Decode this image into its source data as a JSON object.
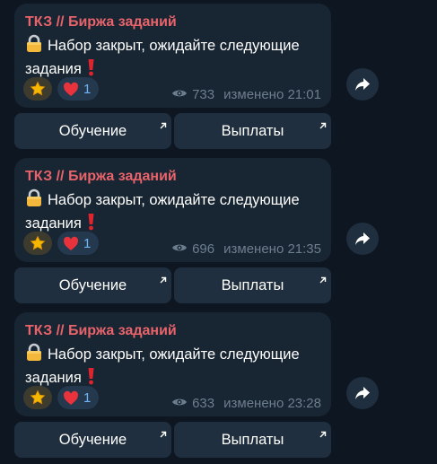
{
  "colors": {
    "background": "#0e1621",
    "bubble": "#182533",
    "channel_name": "#e8636a",
    "button": "#1f2f3f",
    "meta_text": "#6d7f8f",
    "reaction_count": "#6fb3f2"
  },
  "posts": [
    {
      "channel": "ТКЗ // Биржа заданий",
      "text_line1": "Набор закрыт, ожидайте следующие",
      "text_line2": "задания",
      "heart_count": "1",
      "views": "733",
      "edited": "изменено 21:01",
      "button_left": "Обучение",
      "button_right": "Выплаты"
    },
    {
      "channel": "ТКЗ // Биржа заданий",
      "text_line1": "Набор закрыт, ожидайте следующие",
      "text_line2": "задания",
      "heart_count": "1",
      "views": "696",
      "edited": "изменено 21:35",
      "button_left": "Обучение",
      "button_right": "Выплаты"
    },
    {
      "channel": "ТКЗ // Биржа заданий",
      "text_line1": "Набор закрыт, ожидайте следующие",
      "text_line2": "задания",
      "heart_count": "1",
      "views": "633",
      "edited": "изменено 23:28",
      "button_left": "Обучение",
      "button_right": "Выплаты"
    }
  ]
}
